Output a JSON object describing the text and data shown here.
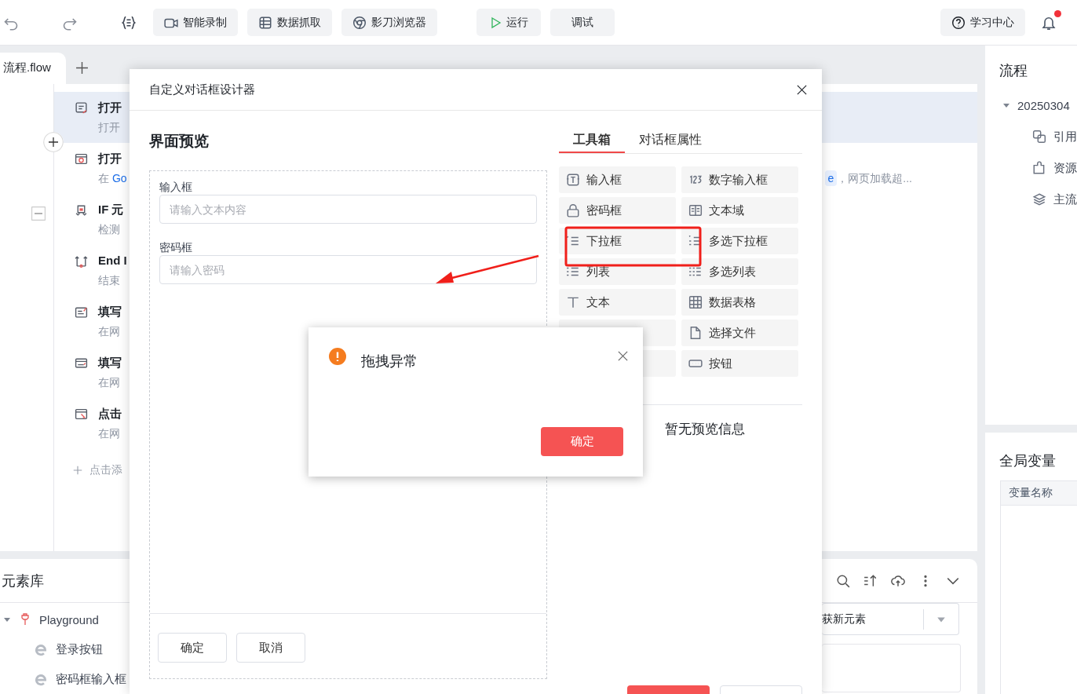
{
  "toolbar": {
    "buttons": [
      {
        "label": "智能录制"
      },
      {
        "label": "数据抓取"
      },
      {
        "label": "影刀浏览器"
      }
    ],
    "run": "运行",
    "debug": "调试",
    "help": "学习中心",
    "notification": {
      "unread": true
    }
  },
  "tabs": [
    {
      "label": "流程.flow",
      "selected": true
    }
  ],
  "flow": {
    "steps": [
      {
        "kind": "step",
        "title": "打开",
        "subtitle": "打开",
        "selected": true
      },
      {
        "kind": "step",
        "title": "打开",
        "subtitle": "在",
        "link": "Go",
        "chip": "e",
        "tail": "，网页加载超...",
        "selected": false
      },
      {
        "kind": "block",
        "title": "IF 元",
        "subtitle": "检测",
        "selected": false,
        "expanded": true
      },
      {
        "kind": "step",
        "title": "End I",
        "subtitle": "结束",
        "selected": false
      },
      {
        "kind": "step",
        "title": "填写",
        "subtitle": "在网",
        "selected": false
      },
      {
        "kind": "step",
        "title": "填写",
        "subtitle": "在网",
        "selected": false
      },
      {
        "kind": "step",
        "title": "点击",
        "subtitle": "在网",
        "selected": false
      }
    ],
    "add_step": "点击添"
  },
  "element_library": {
    "title": "元素库",
    "tree": [
      {
        "label": "Playground",
        "expanded": true,
        "children": [
          {
            "label": "登录按钮"
          },
          {
            "label": "密码框输入框"
          }
        ]
      }
    ],
    "capture_select": "获新元素"
  },
  "side": {
    "title": "流程",
    "tree": [
      {
        "label": "20250304",
        "expanded": true,
        "children": [
          {
            "label": "引用"
          },
          {
            "label": "资源"
          },
          {
            "label": "主流"
          }
        ]
      }
    ],
    "globals_title": "全局变量",
    "globals_columns": [
      "变量名称"
    ]
  },
  "designer": {
    "title": "自定义对话框设计器",
    "preview_title": "界面预览",
    "fields": [
      {
        "label": "输入框",
        "placeholder": "请输入文本内容"
      },
      {
        "label": "密码框",
        "placeholder": "请输入密码"
      }
    ],
    "preview_buttons": [
      "确定",
      "取消"
    ],
    "tabs": [
      {
        "label": "工具箱",
        "selected": true
      },
      {
        "label": "对话框属性",
        "selected": false
      }
    ],
    "toolbox": [
      {
        "kind": "tool",
        "label": "输入框"
      },
      {
        "kind": "tool",
        "label": "数字输入框"
      },
      {
        "kind": "tool",
        "label": "密码框"
      },
      {
        "kind": "tool",
        "label": "文本域"
      },
      {
        "kind": "tool",
        "label": "下拉框"
      },
      {
        "kind": "tool",
        "label": "多选下拉框"
      },
      {
        "kind": "tool",
        "label": "列表"
      },
      {
        "kind": "tool",
        "label": "多选列表"
      },
      {
        "kind": "tool",
        "label": "文本"
      },
      {
        "kind": "tool",
        "label": "数据表格"
      },
      {
        "kind": "covered"
      },
      {
        "kind": "tool",
        "label": "选择文件"
      },
      {
        "kind": "covered"
      },
      {
        "kind": "tool",
        "label": "按钮"
      }
    ],
    "empty_preview": "暂无预览信息"
  },
  "alert": {
    "title": "拖拽异常",
    "ok": "确定"
  }
}
